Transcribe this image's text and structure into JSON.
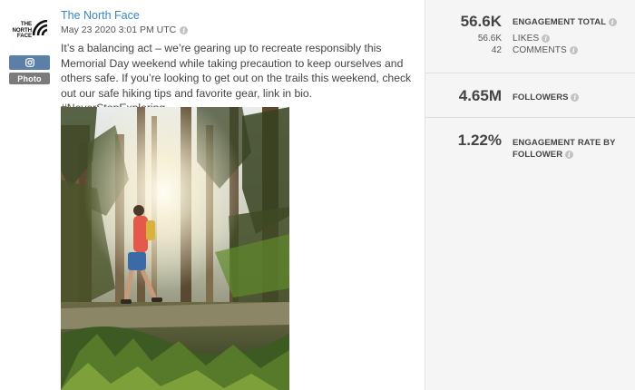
{
  "post": {
    "author": "The North Face",
    "date": "May 23 2020 3:01 PM UTC",
    "caption": "It’s a balancing act – we’re gearing up to recreate responsibly this Memorial Day weekend while taking precaution to keep ourselves and others safe. If you’re looking to get out on the trails this weekend, check out our safe hiking tips and favorite gear, link in bio. #NeverStopExploring",
    "network_icon": "instagram-icon",
    "type_badge": "Photo",
    "logo_text": "THE NORTH FACE"
  },
  "stats": {
    "engagement_total": {
      "value": "56.6K",
      "label": "ENGAGEMENT TOTAL"
    },
    "likes": {
      "value": "56.6K",
      "label": "LIKES"
    },
    "comments": {
      "value": "42",
      "label": "COMMENTS"
    },
    "followers": {
      "value": "4.65M",
      "label": "FOLLOWERS"
    },
    "engagement_rate": {
      "value": "1.22%",
      "label_line1": "ENGAGEMENT RATE BY",
      "label_line2": "FOLLOWER"
    }
  },
  "colors": {
    "author_link": "#3a86c4",
    "instagram_badge": "#5b7fa6",
    "photo_badge": "#7b7b7b",
    "stats_bg": "#f5f5f5"
  }
}
